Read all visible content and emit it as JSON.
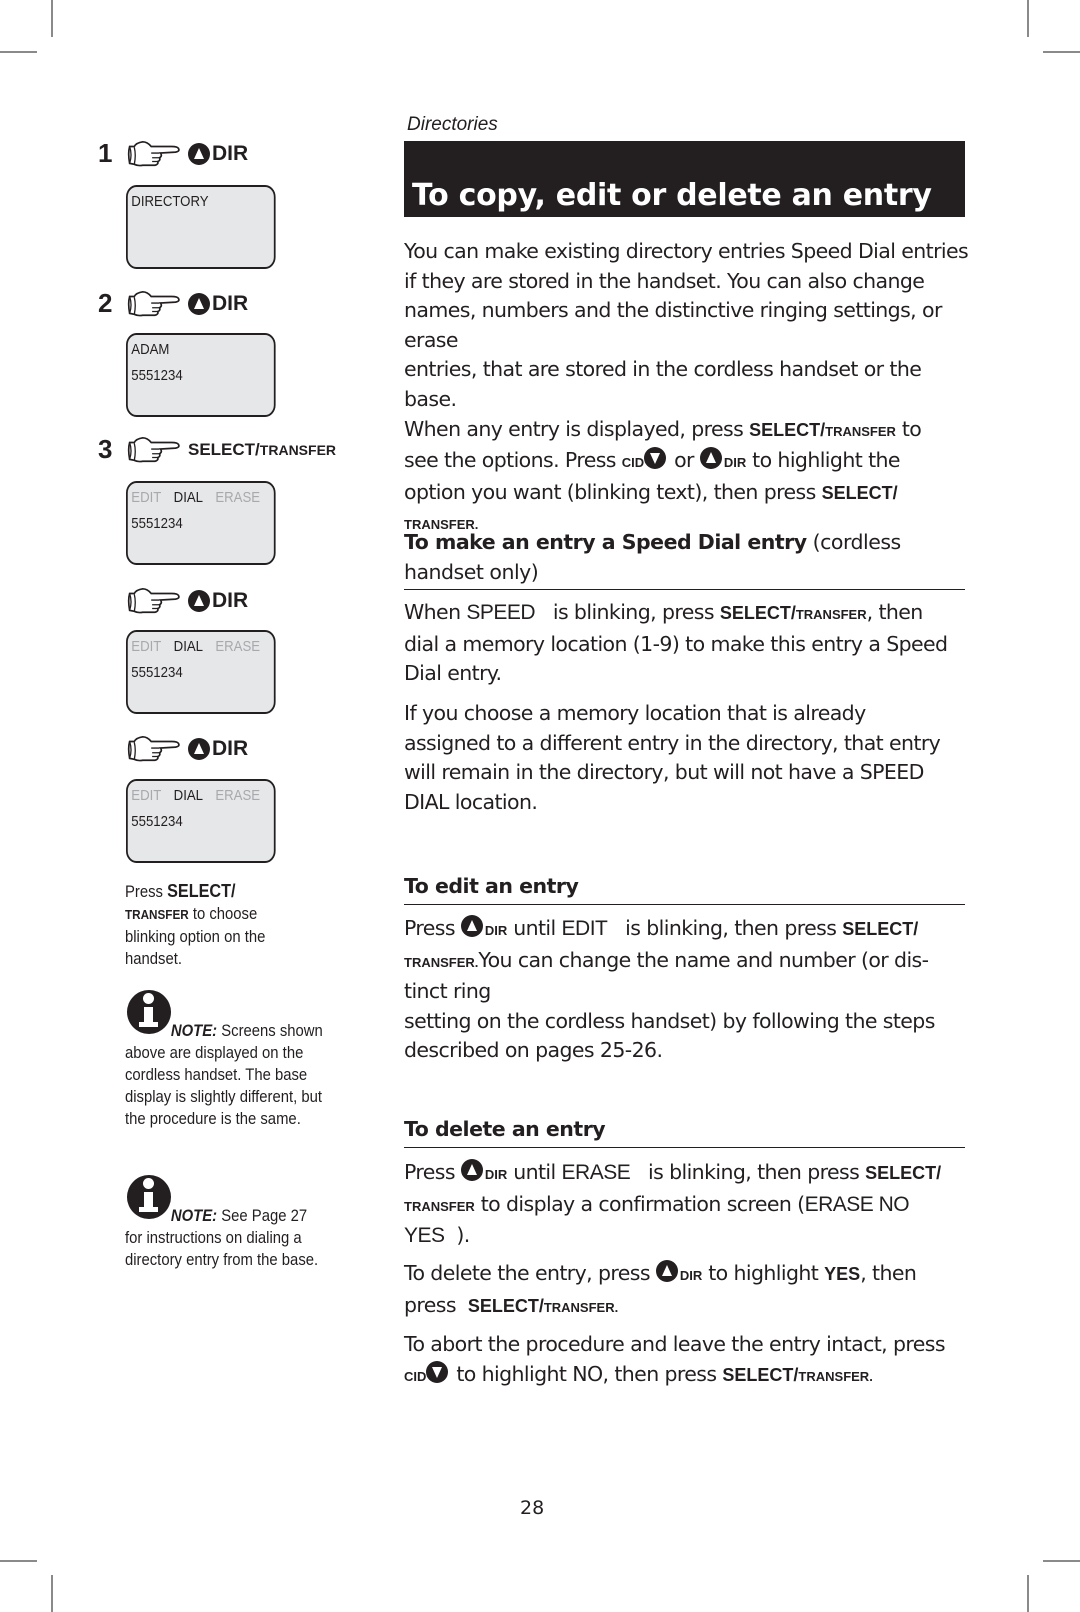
{
  "header": {
    "section": "Directories",
    "title": "To copy, edit or delete an entry"
  },
  "steps": [
    {
      "number": "1",
      "key": "DIR",
      "key_icon": "up-arrow-icon"
    },
    {
      "number": "2",
      "key": "DIR",
      "key_icon": "up-arrow-icon"
    },
    {
      "number": "3",
      "key_main": "SELECT/",
      "key_small": "TRANSFER"
    },
    {
      "number": "",
      "key": "DIR",
      "key_icon": "up-arrow-icon"
    },
    {
      "number": "",
      "key": "DIR",
      "key_icon": "up-arrow-icon"
    }
  ],
  "screens": [
    {
      "line1": "DIRECTORY",
      "line2": ""
    },
    {
      "line1": "ADAM",
      "line2": "5551234"
    },
    {
      "options": [
        "EDIT",
        "DIAL",
        "ERASE"
      ],
      "line2": "5551234"
    },
    {
      "options": [
        "EDIT",
        "DIAL",
        "ERASE"
      ],
      "line2": "5551234"
    },
    {
      "options": [
        "EDIT",
        "DIAL",
        "ERASE"
      ],
      "line2": "5551234"
    }
  ],
  "sidebar": {
    "press_label": "Press",
    "select_key": "SELECT/",
    "transfer_key": "TRANSFER",
    "press_rest_1": "to choose",
    "press_rest_2": "blinking option on the",
    "press_rest_3": "handset.",
    "note1_label": "NOTE:",
    "note1_first": "Screens shown",
    "note1_lines": [
      "above are displayed on the",
      "cordless handset. The base",
      "display is slightly different, but",
      "the procedure is the same."
    ],
    "note2_label": "NOTE:",
    "note2_first": "See Page 27",
    "note2_lines": [
      "for instructions on dialing a",
      "directory entry from the base."
    ]
  },
  "intro": {
    "line1": "You can make existing directory entries Speed Dial entries",
    "line2": "if they are stored in the handset. You can also change",
    "line3": "names, numbers and the distinctive ringing settings, or erase",
    "line4": "entries, that are stored in the cordless handset or the base.",
    "line5a": "When any entry is displayed, press",
    "line5b": "to",
    "line6a": "see the options. Press",
    "line6b": "or",
    "line6c": "to highlight the",
    "line7": "option you want (blinking text), then press",
    "select": "SELECT/",
    "transfer": "TRANSFER",
    "transfer_end": "TRANSFER.",
    "cid": "CID",
    "dir": "DIR"
  },
  "speed_dial": {
    "heading_bold": "To make an entry a Speed Dial entry",
    "heading_rest": "(cordless",
    "heading_line2": "handset only)",
    "p1a": "When",
    "p1_lcd": "SPEED",
    "p1b": "is blinking, press",
    "p1c": ", then",
    "p1_line2": "dial a memory location (1-9) to make this entry a Speed",
    "p1_line3": "Dial entry.",
    "p2_line1": "If you choose a memory location that is already",
    "p2_line2": "assigned to a different entry in the directory, that entry",
    "p2_line3": "will remain in the directory, but will not have a SPEED",
    "p2_line4": "DIAL location."
  },
  "edit": {
    "heading": "To edit an entry",
    "a": "Press",
    "b": "until",
    "lcd": "EDIT",
    "c": "is blinking, then press",
    "d": "You can change the name and number (or dis-",
    "line3": "tinct ring",
    "line4": "setting on the cordless handset) by following the steps",
    "line5": "described on pages 25-26."
  },
  "delete": {
    "heading": "To delete an entry",
    "a": "Press",
    "b": "until",
    "lcd": "ERASE",
    "c": "is blinking, then press",
    "d": "to display a confirmation screen (",
    "lcd2": "ERASE NO",
    "line3_lcd": "YES",
    "line3_end": ").",
    "p2a": "To delete the entry, press",
    "p2b": "to highlight",
    "p2_yes": "YES",
    "p2c": ", then",
    "p2_line2a": "press",
    "p3_line1": "To abort the procedure and leave the entry intact, press",
    "p3b": "to highlight NO, then press",
    "select_transfer_end": "TRANSFER."
  },
  "footer": {
    "page_number": "28"
  }
}
